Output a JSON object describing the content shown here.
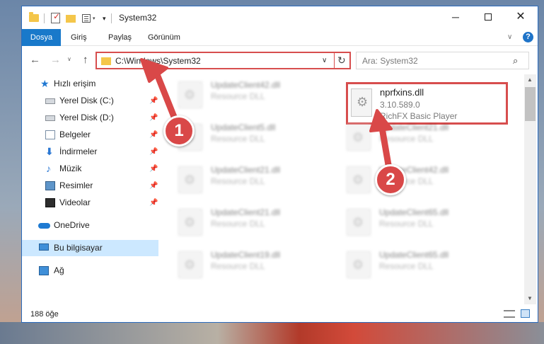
{
  "window": {
    "title": "System32",
    "controls": {
      "minimize": "─",
      "maximize": "",
      "close": "✕"
    }
  },
  "quick_access": {
    "drop_small": "▾",
    "drop": "▾"
  },
  "ribbon": {
    "tabs": [
      {
        "label": "Dosya",
        "active": true
      },
      {
        "label": "Giriş",
        "active": false
      },
      {
        "label": "Paylaş",
        "active": false
      },
      {
        "label": "Görünüm",
        "active": false
      }
    ],
    "expand_glyph": "∨",
    "help_glyph": "?"
  },
  "nav": {
    "back": "←",
    "forward": "→",
    "recent": "∨",
    "up": "↑",
    "address": "C:\\Windows\\System32",
    "address_dropdown": "∨",
    "refresh": "↻",
    "search_placeholder": "Ara: System32",
    "search_icon": "⌕"
  },
  "sidebar": {
    "pin_glyph": "📌",
    "items": [
      {
        "label": "Hızlı erişim",
        "icon": "star-icon",
        "pinned": false
      },
      {
        "label": "Yerel Disk (C:)",
        "icon": "drive-icon",
        "pinned": true
      },
      {
        "label": "Yerel Disk (D:)",
        "icon": "drive-icon",
        "pinned": true
      },
      {
        "label": "Belgeler",
        "icon": "document-icon",
        "pinned": true
      },
      {
        "label": "İndirmeler",
        "icon": "download-icon",
        "pinned": true
      },
      {
        "label": "Müzik",
        "icon": "music-icon",
        "pinned": true
      },
      {
        "label": "Resimler",
        "icon": "pictures-icon",
        "pinned": true
      },
      {
        "label": "Videolar",
        "icon": "video-icon",
        "pinned": true
      },
      {
        "label": "OneDrive",
        "icon": "cloud-icon",
        "pinned": false
      },
      {
        "label": "Bu bilgisayar",
        "icon": "computer-icon",
        "pinned": false,
        "selected": true
      },
      {
        "label": "Ağ",
        "icon": "network-icon",
        "pinned": false
      }
    ],
    "star_glyph": "★",
    "download_glyph": "⬇",
    "music_glyph": "♪"
  },
  "files": {
    "left_column": [
      {
        "name": "UpdateClient42.dll",
        "desc": "Resource DLL"
      },
      {
        "name": "UpdateClient5.dll",
        "desc": "Resource DLL"
      },
      {
        "name": "UpdateClient21.dll",
        "desc": "Resource DLL"
      },
      {
        "name": "UpdateClient21.dll",
        "desc": "Resource DLL"
      },
      {
        "name": "UpdateClient19.dll",
        "desc": "Resource DLL"
      }
    ],
    "right_column": [
      {
        "name": "UpdateClient21.dll",
        "desc": "Resource DLL"
      },
      {
        "name": "UpdateClient42.dll",
        "desc": "Resource DLL"
      },
      {
        "name": "UpdateClient65.dll",
        "desc": "Resource DLL"
      },
      {
        "name": "UpdateClient65.dll",
        "desc": "Resource DLL"
      }
    ],
    "target": {
      "name": "nprfxins.dll",
      "version": "3.10.589.0",
      "desc": "RichFX Basic Player"
    }
  },
  "scrollbar": {
    "up": "▲",
    "down": "▼"
  },
  "status": {
    "item_count": "188 öğe"
  },
  "annotations": {
    "badge_1": "1",
    "badge_2": "2",
    "color": "#d94848"
  },
  "colors": {
    "accent": "#1979ca",
    "highlight_border": "#d74e4e",
    "selected_nav": "#cce8ff"
  }
}
